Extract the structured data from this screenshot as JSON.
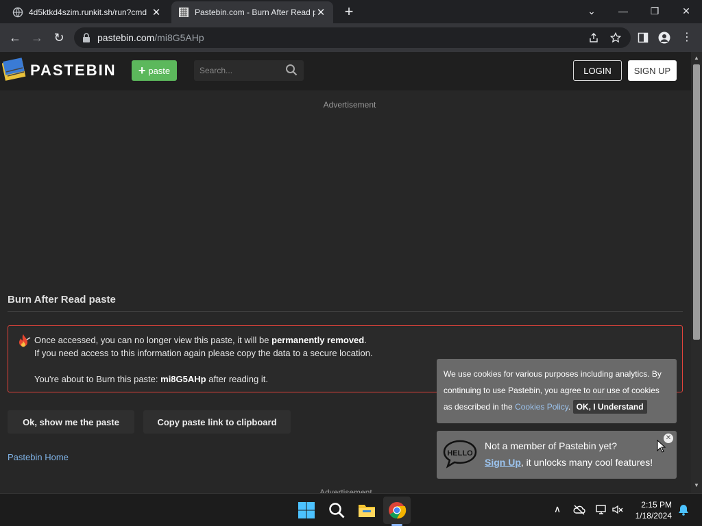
{
  "browser": {
    "tabs": [
      {
        "title": "4d5ktkd4szim.runkit.sh/run?cmd",
        "active": false
      },
      {
        "title": "Pastebin.com - Burn After Read p",
        "active": true
      }
    ],
    "url_host": "pastebin.com",
    "url_path": "/mi8G5AHp"
  },
  "header": {
    "logo_text": "PASTEBIN",
    "paste_button": "paste",
    "search_placeholder": "Search...",
    "login": "LOGIN",
    "signup": "SIGN UP"
  },
  "content": {
    "ad_label": "Advertisement",
    "burn_title": "Burn After Read paste",
    "burn_line1_a": "Once accessed, you can no longer view this paste, it will be ",
    "burn_line1_b": "permanently removed",
    "burn_line1_c": ".",
    "burn_line2": "If you need access to this information again please copy the data to a secure location.",
    "burn_line3_a": "You're about to Burn this paste: ",
    "burn_line3_b": "mi8G5AHp",
    "burn_line3_c": " after reading it.",
    "show_button": "Ok, show me the paste",
    "copy_button": "Copy paste link to clipboard",
    "home_link": "Pastebin Home",
    "ad_label_bottom": "Advertisement"
  },
  "cookie_notice": {
    "text": "We use cookies for various purposes including analytics. By continuing to use Pastebin, you agree to our use of cookies as described in the ",
    "link": "Cookies Policy",
    "after_link": ".",
    "ok_button": "OK, I Understand"
  },
  "member_notice": {
    "line1": "Not a member of Pastebin yet?",
    "signup_link": "Sign Up",
    "line2_rest": ", it unlocks many cool features!"
  },
  "taskbar": {
    "time": "2:15 PM",
    "date": "1/18/2024"
  },
  "colors": {
    "accent_green": "#5cb85c",
    "burn_border": "#e0433b",
    "link_blue": "#7fb2e5"
  }
}
